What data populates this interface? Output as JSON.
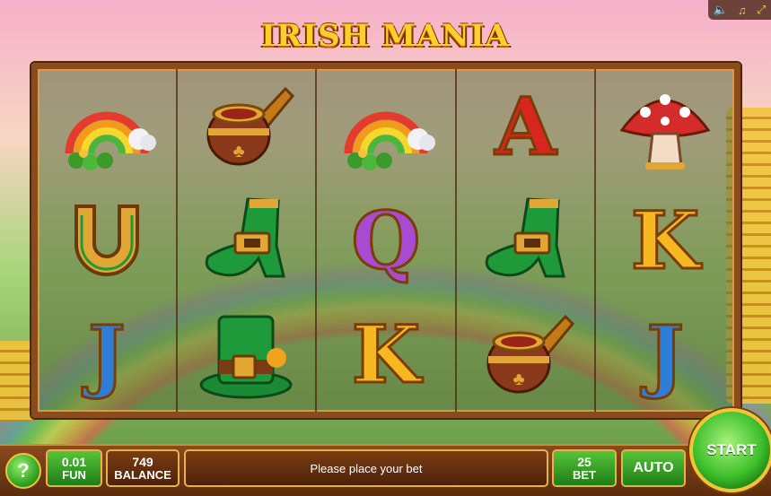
{
  "game": {
    "title": "IRISH MANIA"
  },
  "top_controls": [
    {
      "name": "sound",
      "icon": "speaker-icon"
    },
    {
      "name": "music",
      "icon": "music-note-icon"
    },
    {
      "name": "fullscreen",
      "icon": "expand-icon"
    }
  ],
  "reels": [
    [
      "rainbow",
      "horseshoe",
      "J"
    ],
    [
      "pipe",
      "boot",
      "top-hat"
    ],
    [
      "rainbow",
      "Q",
      "K"
    ],
    [
      "A",
      "boot",
      "pipe"
    ],
    [
      "mushroom",
      "K",
      "J"
    ]
  ],
  "panel": {
    "help_label": "?",
    "coin_value": "0.01",
    "coin_label": "FUN",
    "balance_value": "749",
    "balance_label": "BALANCE",
    "message": "Please place your bet",
    "bet_value": "25",
    "bet_label": "BET",
    "auto_label": "AUTO",
    "start_label": "START"
  },
  "colors": {
    "accent_gold": "#f2c43a",
    "panel_brown": "#5b2c0d",
    "button_green": "#3cbf2a"
  }
}
